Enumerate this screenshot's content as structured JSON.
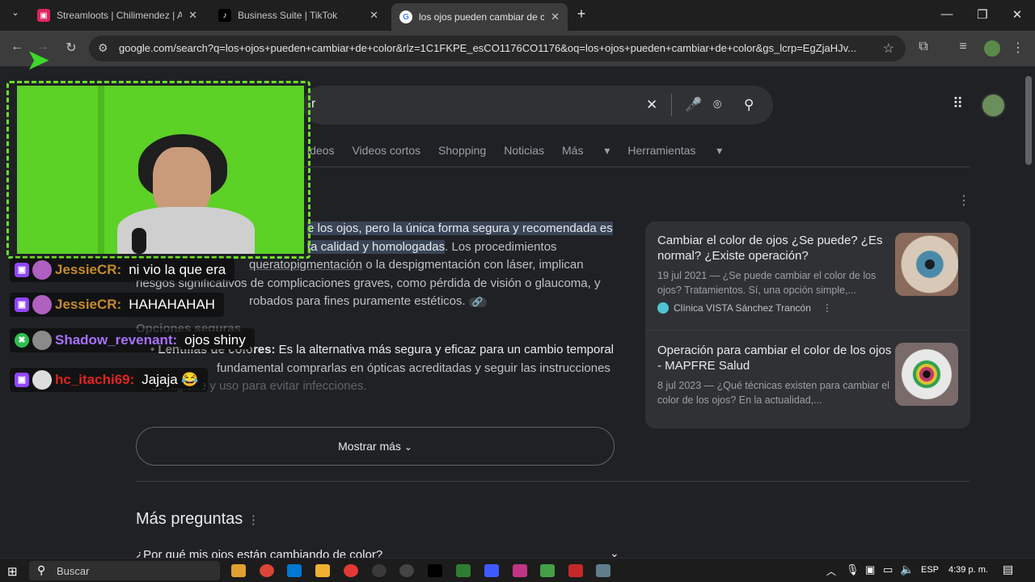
{
  "tabs": [
    {
      "title": "Streamloots | Chilimendez | Ap",
      "close": "✕"
    },
    {
      "title": "Business Suite | TikTok",
      "close": "✕"
    },
    {
      "title": "los ojos pueden cambiar de col",
      "close": "✕"
    }
  ],
  "new_tab": "+",
  "url": "google.com/search?q=los+ojos+pueden+cambiar+de+color&rlz=1C1FKPE_esCO1176CO1176&oq=los+ojos+pueden+cambiar+de+color&gs_lcrp=EgZjaHJv...",
  "search": {
    "query_tail": "r"
  },
  "nav_tabs": [
    "ideos",
    "Videos cortos",
    "Shopping",
    "Noticias",
    "Más",
    "Herramientas"
  ],
  "answer": {
    "line1": "e los ojos, pero la única forma segura y recomendada es",
    "line2a": "ta calidad y homologadas",
    "line2b": ". Los procedimientos",
    "line3a": "queratopigmentación",
    "line3b": " o la despigmentación con láser, implican",
    "line4": "riesgos significativos de complicaciones graves, como pérdida de visión o glaucoma, y",
    "line5": "robados para fines puramente estéticos.",
    "opciones": "Opciones seguras",
    "bullet_bold": "Lentillas de colores:",
    "bullet_text": " Es la alternativa más segura y eficaz para un cambio temporal",
    "bullet_l2a": "fundamental comprarlas en ópticas acreditadas y seguir las instrucciones",
    "bullet_l3": "de higiene y uso para evitar infecciones."
  },
  "cards": [
    {
      "title": "Cambiar el color de ojos ¿Se puede? ¿Es normal? ¿Existe operación?",
      "desc": "19 jul 2021 — ¿Se puede cambiar el color de los ojos? Tratamientos. Sí, una opción simple,...",
      "source": "Clínica VISTA Sánchez Trancón"
    },
    {
      "title": "Operación para cambiar el color de los ojos - MAPFRE Salud",
      "desc": "8 jul 2023 — ¿Qué técnicas existen para cambiar el color de los ojos? En la actualidad,...",
      "source": ""
    }
  ],
  "show_more": "Mostrar más",
  "more_questions": "Más preguntas",
  "question1": "¿Por qué mis ojos están cambiando de color?",
  "chat": [
    {
      "user": "",
      "message": "ni vio la que era",
      "color": "#c58b2b"
    },
    {
      "user": "JessieCR:",
      "message": "",
      "color": "#c58b2b"
    },
    {
      "user": "JessieCR:",
      "message": "HAHAHAHAH",
      "color": "#c58b2b"
    },
    {
      "user": "Shadow_revenant:",
      "message": "ojos shiny",
      "color": "#a970ff"
    },
    {
      "user": "hc_itachi69:",
      "message": "Jajaja 😂",
      "color": "#e0241e"
    }
  ],
  "taskbar": {
    "search": "Buscar",
    "lang": "ESP",
    "time": "4:39 p. m."
  }
}
